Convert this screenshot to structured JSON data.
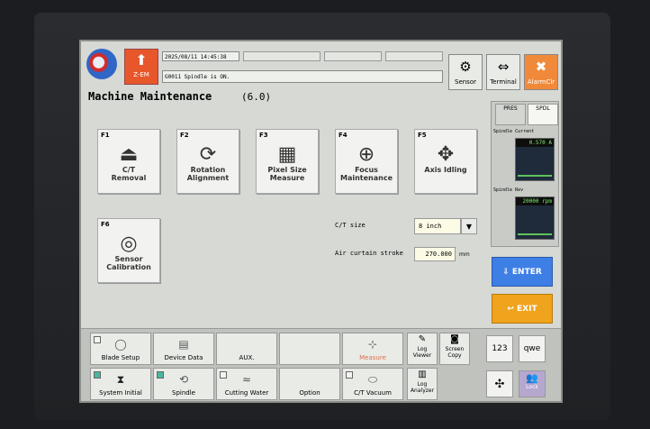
{
  "header": {
    "logo_icon": "disco-logo-icon",
    "zem_label": "Z-EM",
    "datetime": "2025/08/11 14:45:38",
    "status_message": "G0011  Spindle is ON.",
    "sensor_label": "Sensor",
    "terminal_label": "Terminal",
    "alarm_label": "AlarmClr"
  },
  "page": {
    "title": "Machine Maintenance",
    "version": "(6.0)"
  },
  "fkeys": [
    {
      "code": "F1",
      "label": "C/T\nRemoval",
      "icon": "ct-removal-icon"
    },
    {
      "code": "F2",
      "label": "Rotation\nAlignment",
      "icon": "rotation-alignment-icon"
    },
    {
      "code": "F3",
      "label": "Pixel Size\nMeasure",
      "icon": "pixel-grid-icon"
    },
    {
      "code": "F4",
      "label": "Focus\nMaintenance",
      "icon": "focus-icon"
    },
    {
      "code": "F5",
      "label": "Axis Idling",
      "icon": "axis-idling-icon"
    },
    {
      "code": "F6",
      "label": "Sensor\nCalibration",
      "icon": "sensor-calibration-icon"
    }
  ],
  "fields": {
    "ct_size_label": "C/T size",
    "ct_size_value": "8  inch",
    "air_label": "Air curtain stroke",
    "air_value": "270.000",
    "air_unit": "mm"
  },
  "right_panel": {
    "tab_pres": "PRES",
    "tab_spdl": "SPDL",
    "spindle_current_label": "Spindle Current",
    "spindle_current_value": "0.570",
    "spindle_current_unit": "A",
    "spindle_rev_label": "Spindle Rev",
    "spindle_rev_value": "20000",
    "spindle_rev_unit": "rpm"
  },
  "enter_label": "ENTER",
  "exit_label": "EXIT",
  "bottom": {
    "blade_setup": "Blade Setup",
    "device_data": "Device Data",
    "aux": "AUX.",
    "measure": "Measure",
    "log_viewer": "Log\nViewer",
    "screen_copy": "Screen\nCopy",
    "kb_numeric": "123",
    "kb_alpha": "qwe",
    "system_initial": "System Initial",
    "spindle": "Spindle",
    "cutting_water": "Cutting Water",
    "option": "Option",
    "ct_vacuum": "C/T Vacuum",
    "log_analyzer": "Log\nAnalyzer",
    "lock_label": "Lock"
  }
}
